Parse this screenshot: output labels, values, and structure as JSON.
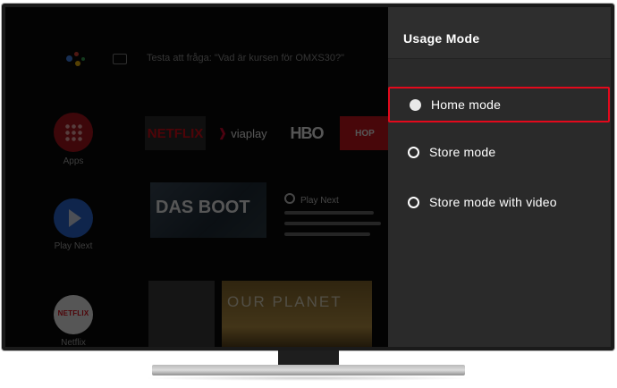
{
  "background": {
    "search_hint": "Testa att fråga: \"Vad är kursen för OMXS30?\"",
    "side_apps": [
      {
        "label": "Apps",
        "icon": "apps-grid-icon"
      },
      {
        "label": "Play Next",
        "icon": "play-icon"
      },
      {
        "label": "Netflix",
        "icon": "netflix-logo"
      }
    ],
    "tiles": [
      "NETFLIX",
      "viaplay",
      "HBO",
      "HOP"
    ],
    "hero_title": "DAS BOOT",
    "play_next_label": "Play Next",
    "bottom_tile_title": "OUR PLANET"
  },
  "menu": {
    "title": "Usage Mode",
    "options": [
      {
        "label": "Home mode",
        "selected": true
      },
      {
        "label": "Store mode",
        "selected": false
      },
      {
        "label": "Store mode with video",
        "selected": false
      }
    ]
  },
  "colors": {
    "accent_highlight": "#e3091c",
    "panel_bg": "#2a2a2a",
    "netflix_red": "#e50914"
  }
}
